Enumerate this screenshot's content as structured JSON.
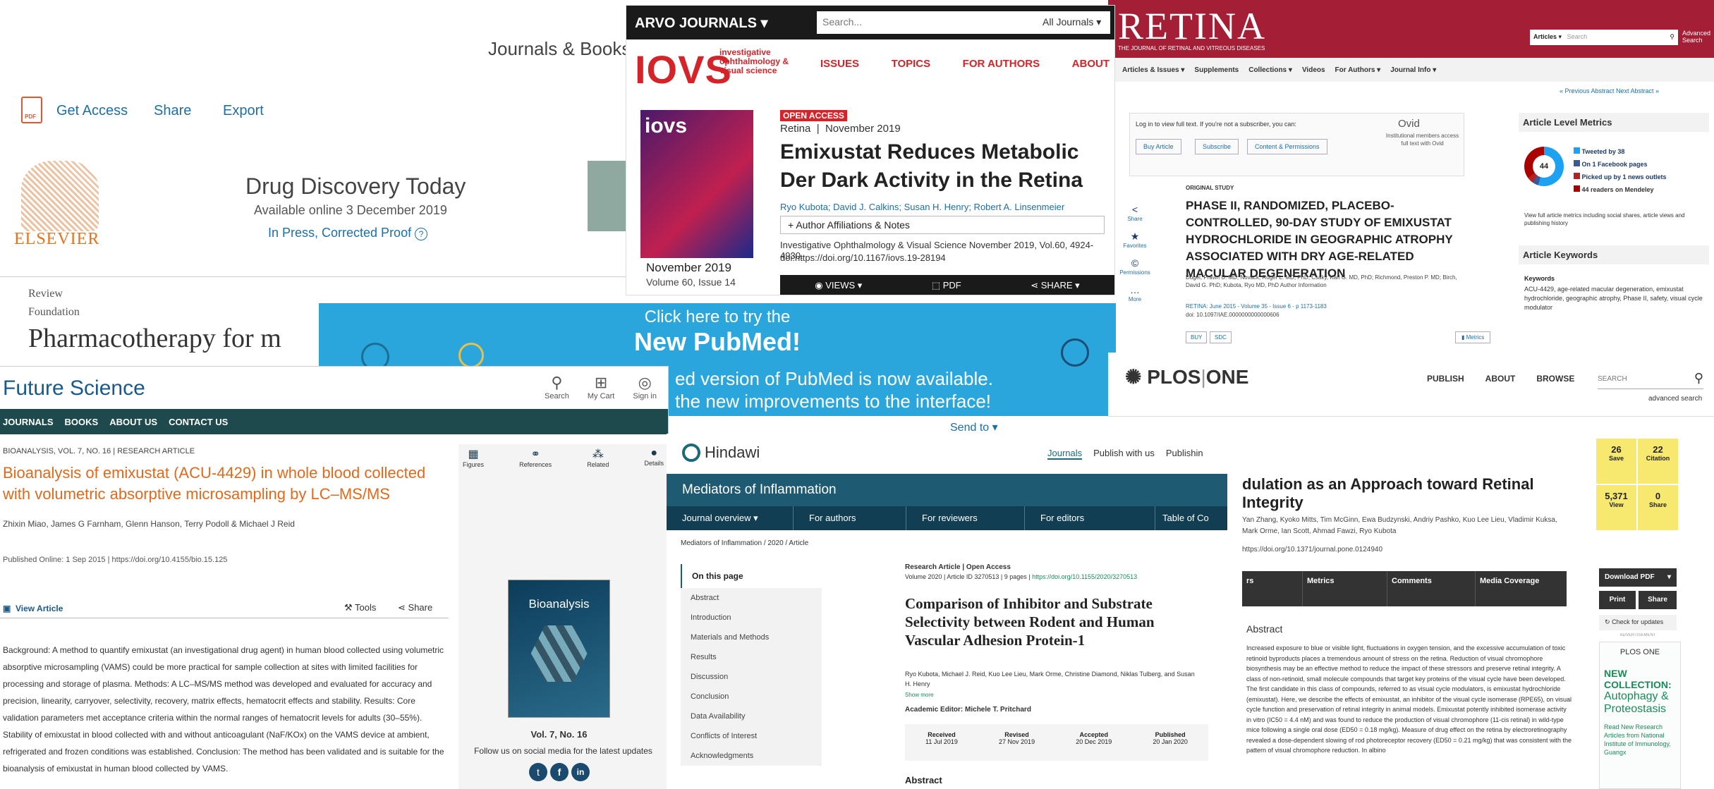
{
  "elsevier": {
    "top_link": "Journals & Books",
    "get_access": "Get Access",
    "share": "Share",
    "export": "Export",
    "publisher": "ELSEVIER",
    "journal": "Drug Discovery Today",
    "available": "Available online 3 December 2019",
    "in_press": "In Press, Corrected Proof",
    "type": "Review",
    "section": "Foundation",
    "title": "Pharmacotherapy for m"
  },
  "arvo": {
    "brand": "ARVO JOURNALS",
    "search_placeholder": "Search...",
    "scope": "All Journals",
    "logo": "IOVS",
    "logo_sub": "investigative ophthalmology & visual science",
    "nav": [
      "ISSUES",
      "TOPICS",
      "FOR AUTHORS",
      "ABOUT"
    ],
    "open_access": "OPEN ACCESS",
    "section": "Retina",
    "date": "November 2019",
    "title": "Emixustat Reduces Metabolic Der Dark Activity in the Retina",
    "authors": "Ryo Kubota; David J. Calkins; Susan H. Henry; Robert A. Linsenmeier",
    "affil": "Author Affiliations & Notes",
    "citation": "Investigative Ophthalmology & Visual Science November 2019, Vol.60, 4924-4930.",
    "doi": "doi:https://doi.org/10.1167/iovs.19-28194",
    "cover_date": "November 2019",
    "cover_vol": "Volume 60, Issue 14",
    "views": "VIEWS",
    "pdf": "PDF",
    "share": "SHARE"
  },
  "retina": {
    "logo": "RETINA",
    "logo_sub": "THE JOURNAL OF RETINAL AND VITREOUS DISEASES",
    "search_scope": "Articles",
    "search_placeholder": "Search",
    "advanced": "Advanced Search",
    "nav": [
      "Articles & Issues",
      "Supplements",
      "Collections",
      "Videos",
      "For Authors",
      "Journal Info"
    ],
    "prev_next": "« Previous Abstract   Next Abstract »",
    "login_text": "Log in to view full text. If you're not a subscriber, you can:",
    "buy": "Buy Article",
    "subscribe": "Subscribe",
    "content": "Content & Permissions",
    "ovid": "Ovid",
    "ovid_text": "Institutional members access full text with Ovid",
    "study_type": "ORIGINAL STUDY",
    "title": "PHASE II, RANDOMIZED, PLACEBO-CONTROLLED, 90-DAY STUDY OF EMIXUSTAT HYDROCHLORIDE IN GEOGRAPHIC ATROPHY ASSOCIATED WITH DRY AGE-RELATED MACULAR DEGENERATION",
    "authors": "Dugel, Pravin U. MD; Novack, Roger L. MD, PhD; Csaky, Karl G. MD, PhD; Richmond, Preston P. MD; Birch, David G. PhD; Kubota, Ryo MD, PhD   Author Information",
    "citation": "RETINA: June 2015 - Volume 35 - Issue 6 - p 1173-1183",
    "doi": "doi: 10.1097/IAE.0000000000000606",
    "side": [
      "Share",
      "Favorites",
      "Permissions",
      "More"
    ],
    "tags": [
      "BUY",
      "SDC"
    ],
    "metrics_btn": "Metrics",
    "alm_title": "Article Level Metrics",
    "score": "44",
    "metrics": [
      "Tweeted by 38",
      "On 1 Facebook pages",
      "Picked up by 1 news outlets",
      "44 readers on Mendeley"
    ],
    "metrics_link": "View full article metrics including social shares, article views and publishing history",
    "kw_title": "Article Keywords",
    "kw_label": "Keywords",
    "keywords": "ACU-4429, age-related macular degeneration, emixustat hydrochloride, geographic atrophy, Phase II, safety, visual cycle modulator",
    "colors": {
      "twitter": "#1da1f2",
      "facebook": "#3b5998",
      "news": "#b22222",
      "mendeley": "#a00"
    }
  },
  "pubmed": {
    "line1": "Click here to try the",
    "line2": "New PubMed!",
    "line3": "ed version of PubMed is now available.",
    "line4": "the new improvements to the interface!",
    "send_to": "Send to"
  },
  "future": {
    "logo": "Future Science",
    "icons": [
      "Search",
      "My Cart",
      "Sign in"
    ],
    "nav": [
      "JOURNALS",
      "BOOKS",
      "ABOUT US",
      "CONTACT US"
    ],
    "meta": "BIOANALYSIS, VOL. 7, NO. 16  |  RESEARCH ARTICLE",
    "title": "Bioanalysis of emixustat (ACU-4429) in whole blood collected with volumetric absorptive microsampling by LC–MS/MS",
    "authors": "Zhixin Miao, James G Farnham, Glenn Hanson, Terry Podoll & Michael J Reid",
    "published": "Published Online: 1 Sep 2015 | https://doi.org/10.4155/bio.15.125",
    "view_article": "View Article",
    "tools": "Tools",
    "share": "Share",
    "tabs": [
      "Figures",
      "References",
      "Related",
      "Details"
    ],
    "abstract": "Background: A method to quantify emixustat (an investigational drug agent) in human blood collected using volumetric absorptive microsampling (VAMS) could be more practical for sample collection at sites with limited facilities for processing and storage of plasma. Methods: A LC–MS/MS method was developed and evaluated for accuracy and precision, linearity, carryover, selectivity, recovery, matrix effects, hematocrit effects and stability. Results: Core validation parameters met acceptance criteria within the normal ranges of hematocrit levels for adults (30–55%). Stability of emixustat in blood collected with and without anticoagulant (NaF/KOx) on the VAMS device at ambient, refrigerated and frozen conditions was established. Conclusion: The method has been validated and is suitable for the bioanalysis of emixustat in human blood collected by VAMS.",
    "cover_title": "Bioanalysis",
    "vol": "Vol. 7, No. 16",
    "follow": "Follow us on social media for the latest updates"
  },
  "hindawi": {
    "logo": "Hindawi",
    "top_nav": [
      "Journals",
      "Publish with us",
      "Publishin"
    ],
    "journal": "Mediators of Inflammation",
    "nav": [
      "Journal overview",
      "For authors",
      "For reviewers",
      "For editors",
      "Table of Co"
    ],
    "breadcrumb": "Mediators of Inflammation / 2020 / Article",
    "toc_title": "On this page",
    "toc": [
      "Abstract",
      "Introduction",
      "Materials and Methods",
      "Results",
      "Discussion",
      "Conclusion",
      "Data Availability",
      "Conflicts of Interest",
      "Acknowledgments"
    ],
    "type": "Research Article | Open Access",
    "volume": "Volume 2020 | Article ID 3270513 | 9 pages |",
    "doi": "https://doi.org/10.1155/2020/3270513",
    "title": "Comparison of Inhibitor and Substrate Selectivity between Rodent and Human Vascular Adhesion Protein-1",
    "authors": "Ryo Kubota, Michael J. Reid, Kuo Lee Lieu, Mark Orme, Christine Diamond, Niklas Tulberg, and Susan H. Henry",
    "show_more": "Show more",
    "editor": "Academic Editor: Michele T. Pritchard",
    "dates": [
      {
        "label": "Received",
        "value": "11 Jul 2019"
      },
      {
        "label": "Revised",
        "value": "27 Nov 2019"
      },
      {
        "label": "Accepted",
        "value": "20 Dec 2019"
      },
      {
        "label": "Published",
        "value": "20 Jan 2020"
      }
    ],
    "abstract": "Abstract"
  },
  "plos": {
    "logo": "PLOS",
    "logo2": "ONE",
    "nav": [
      "PUBLISH",
      "ABOUT",
      "BROWSE"
    ],
    "search": "SEARCH",
    "advanced": "advanced search",
    "title": "dulation as an Approach toward Retinal Integrity",
    "authors": "Yan Zhang, Kyoko Mitts, Tim McGinn, Ewa Budzynski, Andriy Pashko, Kuo Lee Lieu, Vladimir Kuksa, Mark Orme, Ian Scott, Ahmad Fawzi, Ryo Kubota",
    "doi": "https://doi.org/10.1371/journal.pone.0124940",
    "tabs": [
      "rs",
      "Metrics",
      "Comments",
      "Media Coverage"
    ],
    "abstract_title": "Abstract",
    "abstract": "Increased exposure to blue or visible light, fluctuations in oxygen tension, and the excessive accumulation of toxic retinoid byproducts places a tremendous amount of stress on the retina. Reduction of visual chromophore biosynthesis may be an effective method to reduce the impact of these stressors and preserve retinal integrity. A class of non-retinoid, small molecule compounds that target key proteins of the visual cycle have been developed. The first candidate in this class of compounds, referred to as visual cycle modulators, is emixustat hydrochloride (emixustat). Here, we describe the effects of emixustat, an inhibitor of the visual cycle isomerase (RPE65), on visual cycle function and preservation of retinal integrity in animal models. Emixustat potently inhibited isomerase activity in vitro (IC50 = 4.4 nM) and was found to reduce the production of visual chromophore (11-cis retinal) in wild-type mice following a single oral dose (ED50 = 0.18 mg/kg). Measure of drug effect on the retina by electroretinography revealed a dose-dependent slowing of rod photoreceptor recovery (ED50 = 0.21 mg/kg) that was consistent with the pattern of visual chromophore reduction. In albino",
    "stats": [
      {
        "value": "26",
        "label": "Save"
      },
      {
        "value": "22",
        "label": "Citation"
      },
      {
        "value": "5,371",
        "label": "View"
      },
      {
        "value": "0",
        "label": "Share"
      }
    ],
    "download": "Download PDF",
    "print": "Print",
    "share": "Share",
    "check": "Check for updates",
    "ad": "ADVERTISEMENT",
    "ad_brand": "PLOS ONE",
    "ad_new": "NEW COLLECTION:",
    "ad_topic": "Autophagy & Proteostasis",
    "ad_read": "Read New Research Articles from National Institute of Immunology, Guangx"
  }
}
